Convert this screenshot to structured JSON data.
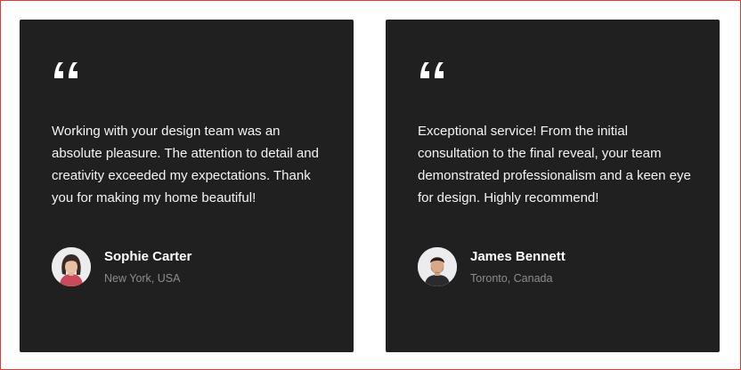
{
  "testimonials": [
    {
      "quote_mark": "quote-icon",
      "text": "Working with your design team was an absolute pleasure. The attention to detail and creativity exceeded my expectations. Thank you for making my home beautiful!",
      "author": {
        "name": "Sophie Carter",
        "location": "New York, USA",
        "avatar_icon": "woman-portrait-avatar"
      }
    },
    {
      "quote_mark": "quote-icon",
      "text": "Exceptional service! From the initial consultation to the final reveal, your team demonstrated professionalism and a keen eye for design. Highly recommend!",
      "author": {
        "name": "James Bennett",
        "location": "Toronto, Canada",
        "avatar_icon": "man-portrait-avatar"
      }
    }
  ],
  "colors": {
    "card_background": "#202020",
    "text": "#f4f4f4",
    "muted_text": "#8c8c8c",
    "page_background": "#ffffff"
  }
}
